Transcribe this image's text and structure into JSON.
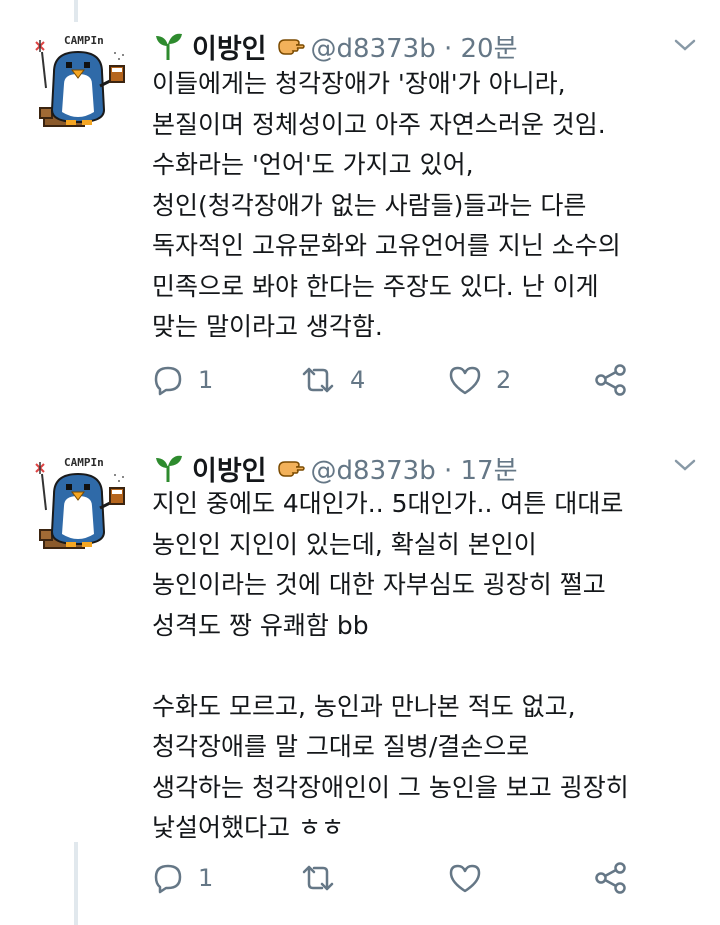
{
  "tweets": [
    {
      "author_name": "이방인",
      "handle_time": "@d8373b · 20분",
      "lines": [
        "이들에게는 청각장애가 '장애'가 아니라,",
        "본질이며 정체성이고 아주 자연스러운 것임.",
        "수화라는 '언어'도 가지고 있어,",
        "청인(청각장애가 없는 사람들)들과는 다른",
        "독자적인 고유문화와 고유언어를 지닌 소수의",
        "민족으로 봐야 한다는 주장도 있다. 난 이게",
        "맞는 말이라고 생각함."
      ],
      "reply_count": "1",
      "retweet_count": "4",
      "like_count": "2"
    },
    {
      "author_name": "이방인",
      "handle_time": "@d8373b · 17분",
      "lines": [
        "지인 중에도 4대인가.. 5대인가.. 여튼 대대로",
        "농인인 지인이 있는데, 확실히 본인이",
        "농인이라는 것에 대한 자부심도 굉장히 쩔고",
        "성격도 짱 유쾌함 bb",
        "",
        "수화도 모르고, 농인과 만나본 적도 없고,",
        "청각장애를 말 그대로 질병/결손으로",
        "생각하는 청각장애인이 그 농인을 보고 굉장히",
        "낯설어했다고 ㅎㅎ"
      ],
      "reply_count": "1",
      "retweet_count": "",
      "like_count": ""
    }
  ],
  "avatar_text": "CAMPIn",
  "colors": {
    "icon_gray": "#657786",
    "text": "#14171a",
    "thread_line": "#e1e8ed",
    "sprout_green": "#2e8b2e"
  }
}
